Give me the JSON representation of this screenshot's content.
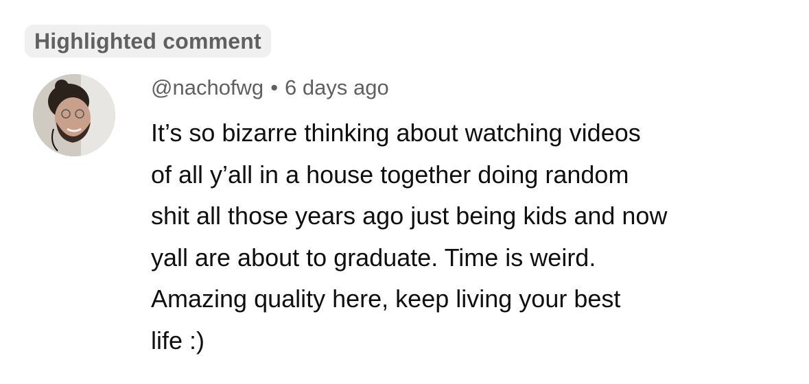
{
  "badge": {
    "label": "Highlighted comment"
  },
  "comment": {
    "author": "@nachofwg",
    "separator": "•",
    "time": "6 days ago",
    "lines": [
      "It’s so bizarre thinking about watching videos",
      "of all y’all in a house together doing random",
      "shit all those years ago just being kids and now",
      "yall are about to graduate. Time is weird.",
      "Amazing quality here, keep living your best",
      "life :)"
    ]
  },
  "colors": {
    "badge_bg": "#f0f0f0",
    "meta_text": "#606060",
    "body_text": "#0f0f0f"
  }
}
